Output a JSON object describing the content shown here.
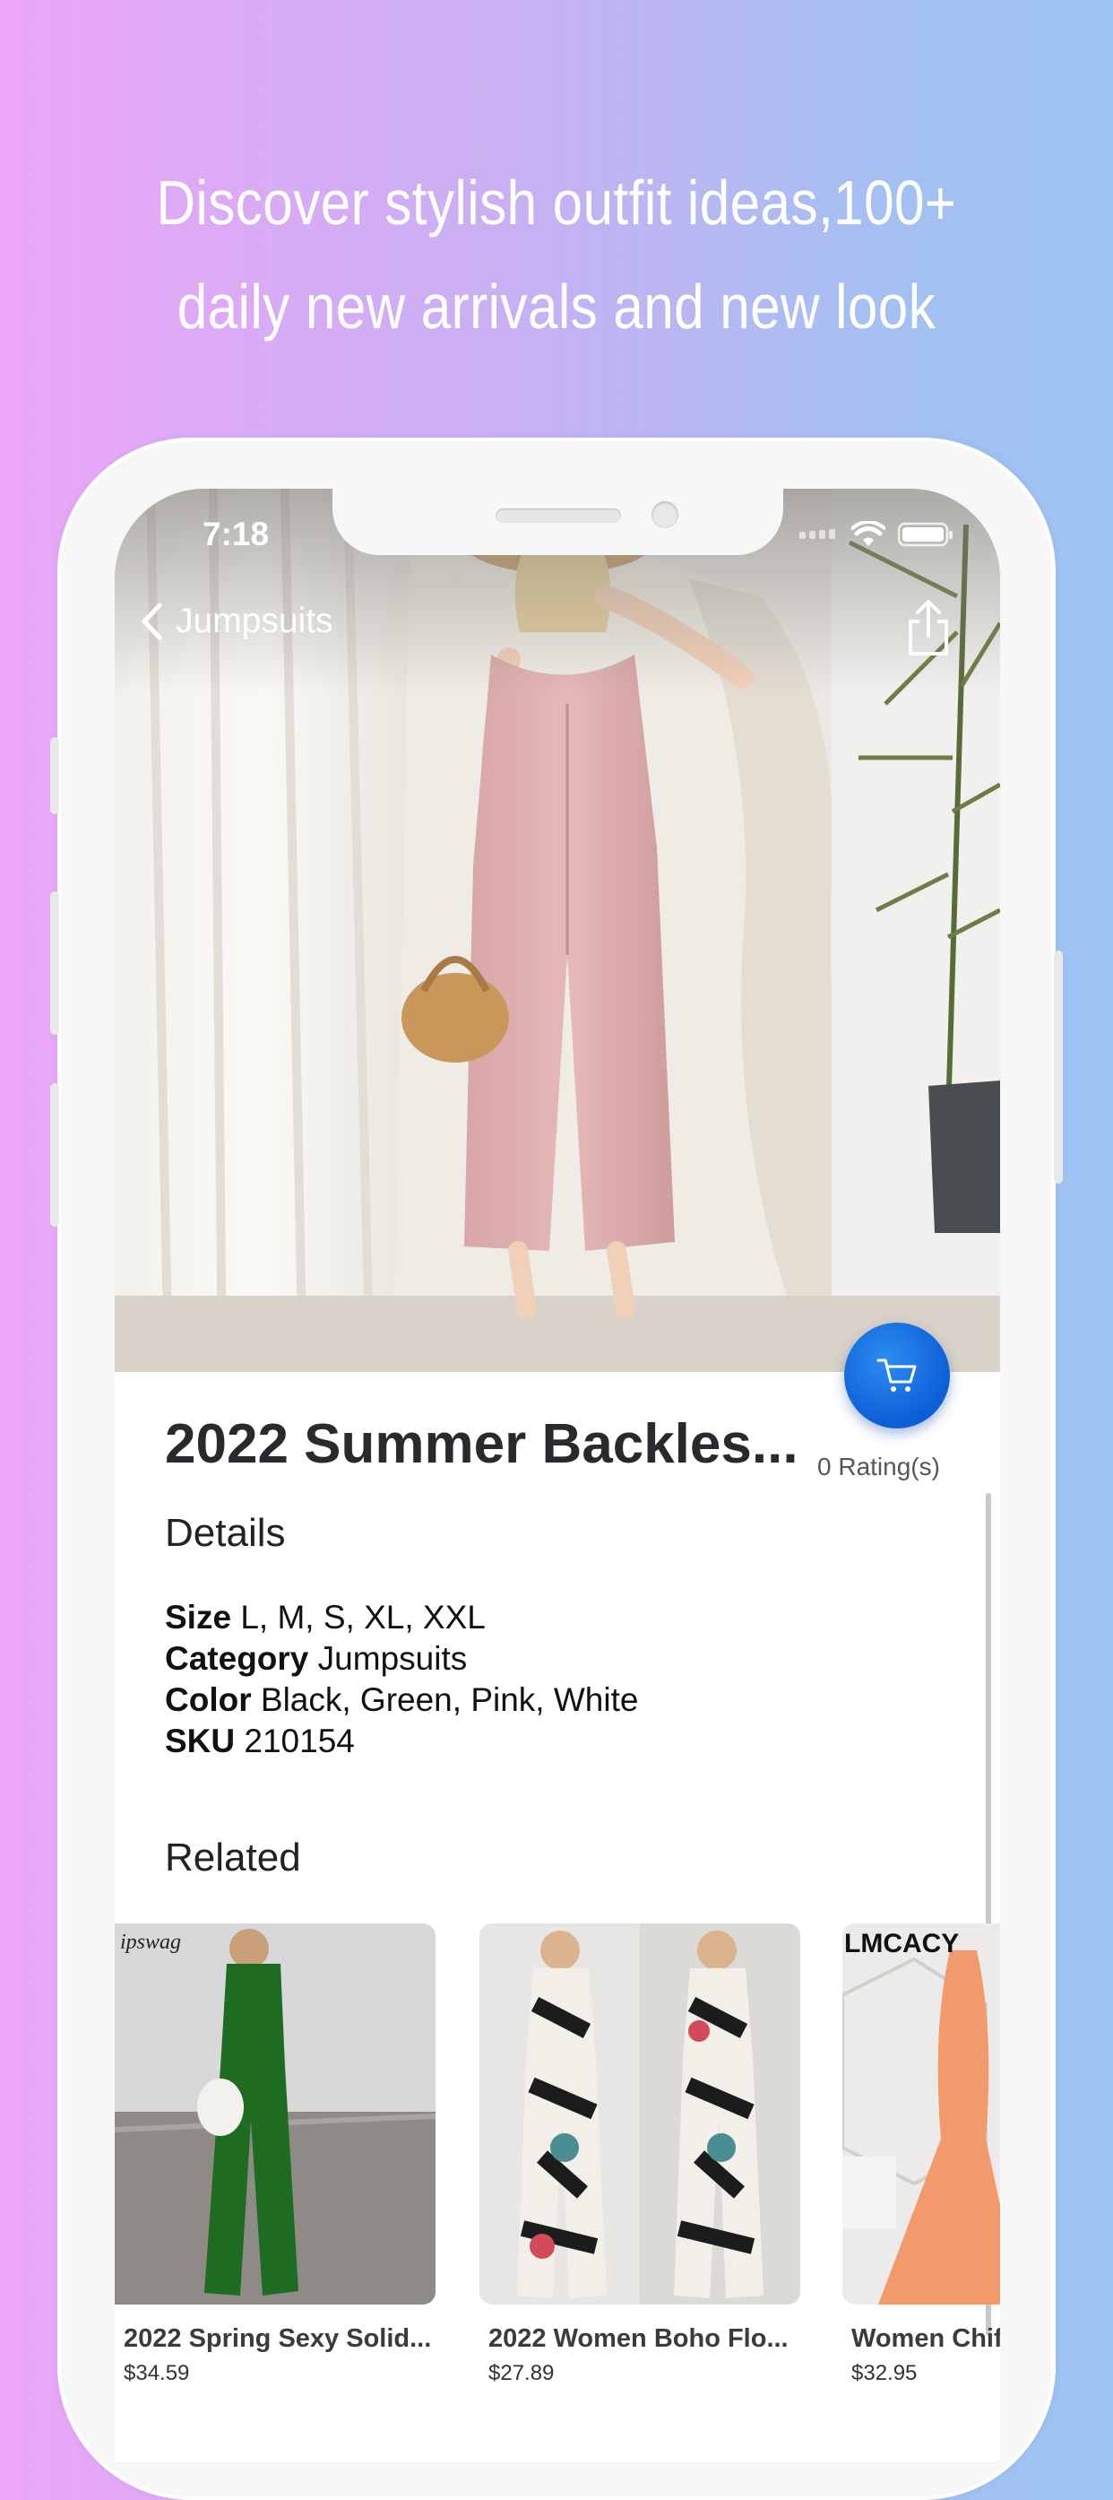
{
  "headline": {
    "line1": "Discover stylish outfit ideas,100+",
    "line2": "daily new arrivals and new look"
  },
  "status_bar": {
    "time": "7:18"
  },
  "nav": {
    "back_label": "Jumpsuits"
  },
  "product": {
    "title": "2022 Summer Backles...",
    "rating": "0 Rating(s)",
    "details_heading": "Details",
    "specs": [
      {
        "label": "Size",
        "value": "L, M, S, XL, XXL"
      },
      {
        "label": "Category",
        "value": "Jumpsuits"
      },
      {
        "label": "Color",
        "value": "Black, Green, Pink, White"
      },
      {
        "label": "SKU",
        "value": "210154"
      }
    ]
  },
  "related": {
    "heading": "Related",
    "items": [
      {
        "title": "2022 Spring Sexy Solid...",
        "price": "$34.59",
        "brand": "ipswag"
      },
      {
        "title": "2022 Women Boho Flo...",
        "price": "$27.89"
      },
      {
        "title": "Women Chif",
        "price": "$32.95",
        "brand": "LMCACY"
      }
    ]
  },
  "colors": {
    "fab": "#0c5fd7",
    "gradient_left": "#eba6f8",
    "gradient_right": "#9cc4f2"
  }
}
